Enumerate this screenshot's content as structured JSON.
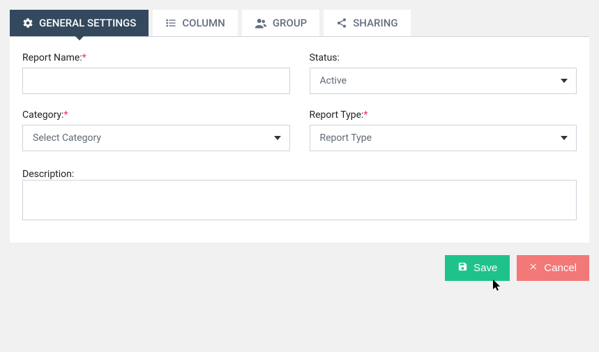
{
  "tabs": {
    "general": "GENERAL SETTINGS",
    "column": "COLUMN",
    "group": "GROUP",
    "sharing": "SHARING"
  },
  "form": {
    "report_name_label": "Report Name:",
    "report_name_value": "",
    "status_label": "Status:",
    "status_value": "Active",
    "category_label": "Category:",
    "category_value": "Select Category",
    "report_type_label": "Report Type:",
    "report_type_value": "Report Type",
    "description_label": "Description:",
    "description_value": ""
  },
  "actions": {
    "save": "Save",
    "cancel": "Cancel"
  },
  "required_marker": "*"
}
